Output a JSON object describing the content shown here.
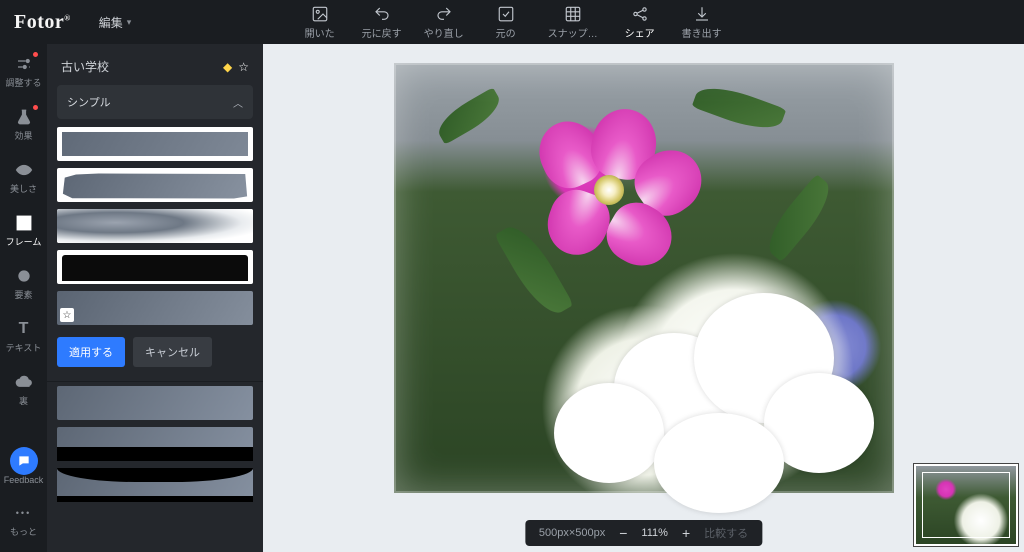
{
  "header": {
    "logo": "Fotor",
    "edit_label": "編集",
    "tools": [
      {
        "id": "open",
        "label": "開いた"
      },
      {
        "id": "undo",
        "label": "元に戻す"
      },
      {
        "id": "redo",
        "label": "やり直し"
      },
      {
        "id": "orig",
        "label": "元の"
      },
      {
        "id": "snap",
        "label": "スナップ…"
      },
      {
        "id": "share",
        "label": "シェア"
      },
      {
        "id": "export",
        "label": "書き出す"
      }
    ]
  },
  "rail": {
    "items": [
      {
        "id": "adjust",
        "label": "調整する"
      },
      {
        "id": "effect",
        "label": "効果"
      },
      {
        "id": "beauty",
        "label": "美しさ"
      },
      {
        "id": "frame",
        "label": "フレーム"
      },
      {
        "id": "element",
        "label": "要素"
      },
      {
        "id": "text",
        "label": "テキスト"
      },
      {
        "id": "cloud",
        "label": "裏"
      }
    ],
    "feedback": "Feedback",
    "more": "もっと"
  },
  "panel": {
    "title": "古い学校",
    "accordion": "シンプル",
    "apply": "適用する",
    "cancel": "キャンセル"
  },
  "zoom": {
    "dimensions": "500px×500px",
    "value": "111%",
    "compare": "比較する"
  }
}
